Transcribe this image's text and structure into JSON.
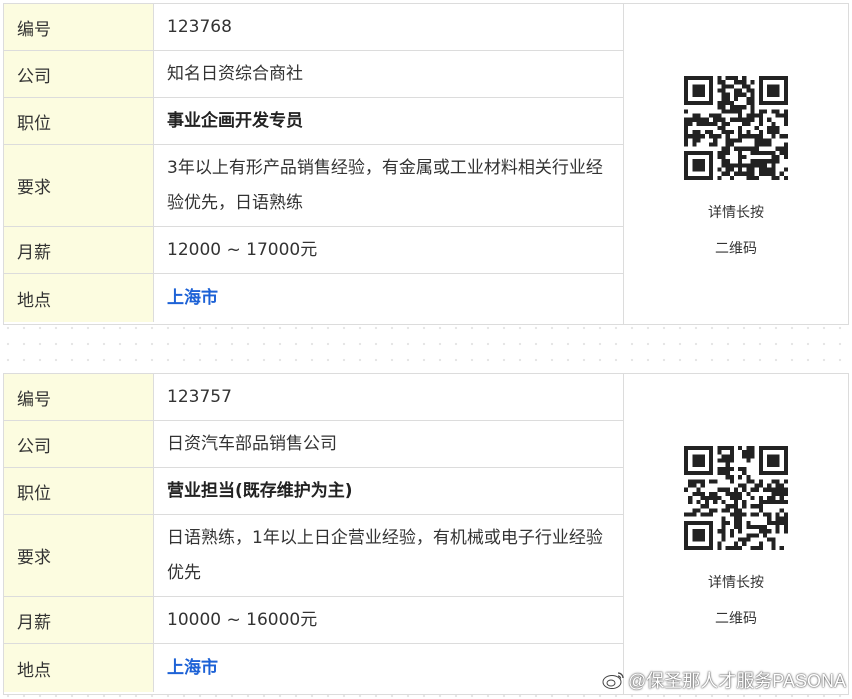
{
  "listings": [
    {
      "fields": [
        {
          "label": "编号",
          "value": "123768"
        },
        {
          "label": "公司",
          "value": "知名日资综合商社"
        },
        {
          "label": "职位",
          "value": "事业企画开发专员"
        },
        {
          "label": "要求",
          "value": "3年以上有形产品销售经验，有金属或工业材料相关行业经验优先，日语熟练"
        },
        {
          "label": "月薪",
          "value": "12000 ~ 17000元"
        },
        {
          "label": "地点",
          "value": "上海市"
        }
      ],
      "qr": {
        "line1": "详情长按",
        "line2": "二维码",
        "icon": "qr-code"
      }
    },
    {
      "fields": [
        {
          "label": "编号",
          "value": "123757"
        },
        {
          "label": "公司",
          "value": "日资汽车部品销售公司"
        },
        {
          "label": "职位",
          "value": "营业担当(既存维护为主)"
        },
        {
          "label": "要求",
          "value": "日语熟练，1年以上日企营业经验，有机械或电子行业经验优先"
        },
        {
          "label": "月薪",
          "value": "10000 ~ 16000元"
        },
        {
          "label": "地点",
          "value": "上海市"
        }
      ],
      "qr": {
        "line1": "详情长按",
        "line2": "二维码",
        "icon": "qr-code"
      }
    }
  ],
  "watermark": {
    "text": "@保圣那人才服务PASONA",
    "icon": "weibo-logo"
  },
  "colors": {
    "label_bg": "#fcfce0",
    "link": "#1d62d6",
    "border": "#dcdcdc"
  }
}
